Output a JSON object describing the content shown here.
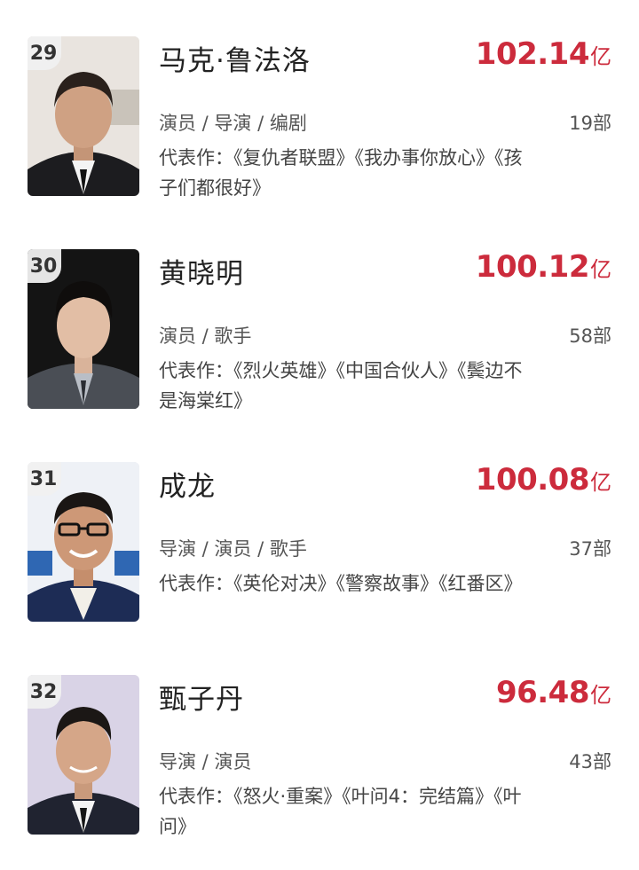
{
  "colors": {
    "box_office_red": "#cc2b3c",
    "name_text": "#222222",
    "meta_text": "#555555",
    "rank_badge_bg": "#f0f0f0"
  },
  "people": [
    {
      "rank": "29",
      "name": "马克·鲁法洛",
      "box_office": "102.14",
      "unit": "亿",
      "roles": "演员 / 导演 / 编剧",
      "count": "19部",
      "works": "代表作：《复仇者联盟》《我办事你放心》《孩子们都很好》",
      "avatar_icon": "actor-portrait-icon"
    },
    {
      "rank": "30",
      "name": "黄晓明",
      "box_office": "100.12",
      "unit": "亿",
      "roles": "演员 / 歌手",
      "count": "58部",
      "works": "代表作：《烈火英雄》《中国合伙人》《鬓边不是海棠红》",
      "avatar_icon": "actor-portrait-icon"
    },
    {
      "rank": "31",
      "name": "成龙",
      "box_office": "100.08",
      "unit": "亿",
      "roles": "导演 / 演员 / 歌手",
      "count": "37部",
      "works": "代表作：《英伦对决》《警察故事》《红番区》",
      "avatar_icon": "actor-portrait-icon"
    },
    {
      "rank": "32",
      "name": "甄子丹",
      "box_office": "96.48",
      "unit": "亿",
      "roles": "导演 / 演员",
      "count": "43部",
      "works": "代表作：《怒火·重案》《叶问4：完结篇》《叶问》",
      "avatar_icon": "actor-portrait-icon"
    }
  ]
}
